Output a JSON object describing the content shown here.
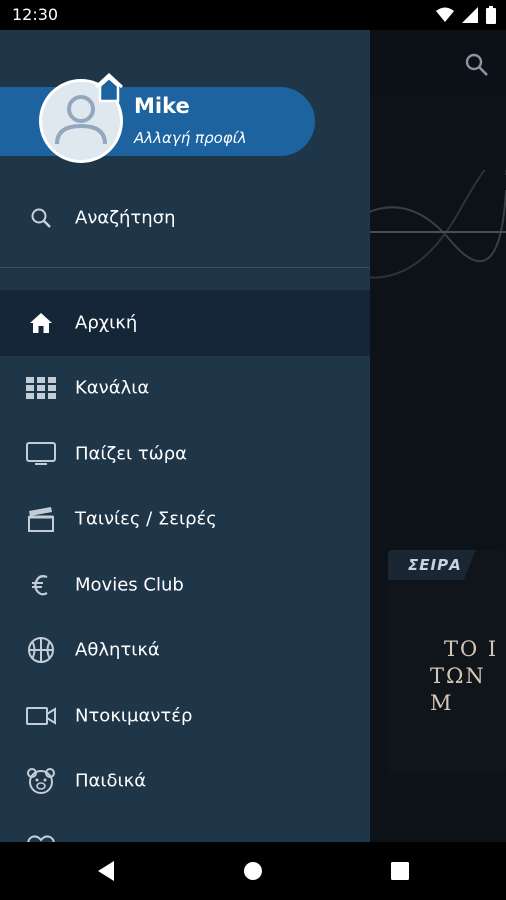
{
  "status_bar": {
    "time": "12:30"
  },
  "background": {
    "series_badge": "ΣΕΙΡΑ",
    "card_title_line1": "ΤΟ Ι",
    "card_title_line2": "ΤΩΝ Μ"
  },
  "profile": {
    "name": "Mike",
    "subtitle": "Αλλαγή προφίλ"
  },
  "search": {
    "label": "Αναζήτηση",
    "icon": "search-icon"
  },
  "menu": {
    "items": [
      {
        "label": "Αρχική",
        "icon": "home-icon",
        "active": true
      },
      {
        "label": "Κανάλια",
        "icon": "grid-icon"
      },
      {
        "label": "Παίζει τώρα",
        "icon": "tv-icon"
      },
      {
        "label": "Ταινίες / Σειρές",
        "icon": "clapperboard-icon"
      },
      {
        "label": "Movies Club",
        "icon": "euro-icon"
      },
      {
        "label": "Αθλητικά",
        "icon": "basketball-icon"
      },
      {
        "label": "Ντοκιμαντέρ",
        "icon": "camera-icon"
      },
      {
        "label": "Παιδικά",
        "icon": "bear-icon"
      }
    ]
  },
  "colors": {
    "drawer": "#1f3548",
    "profile_pill": "#1d639f",
    "active_row": "#142637"
  }
}
